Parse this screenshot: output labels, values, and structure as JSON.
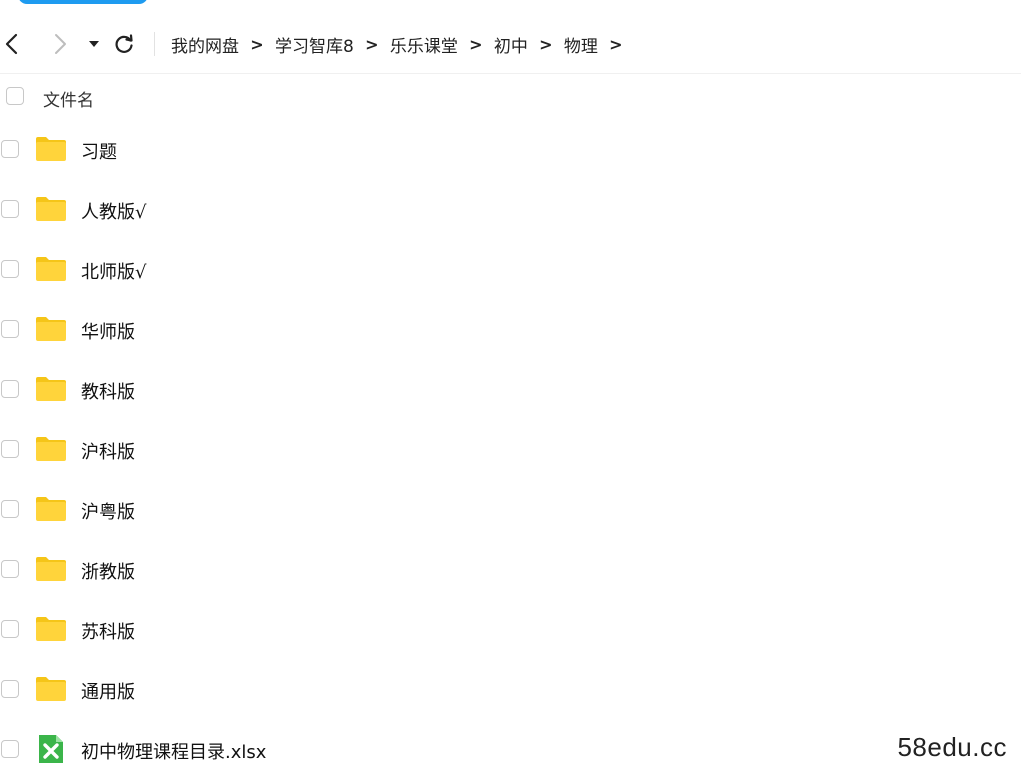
{
  "breadcrumb": [
    {
      "label": "我的网盘"
    },
    {
      "label": "学习智库8"
    },
    {
      "label": "乐乐课堂"
    },
    {
      "label": "初中"
    },
    {
      "label": "物理"
    }
  ],
  "breadcrumb_separator": ">",
  "list_header": {
    "column_label": "文件名"
  },
  "files": [
    {
      "name": "习题",
      "type": "folder"
    },
    {
      "name": "人教版√",
      "type": "folder"
    },
    {
      "name": "北师版√",
      "type": "folder"
    },
    {
      "name": "华师版",
      "type": "folder"
    },
    {
      "name": "教科版",
      "type": "folder"
    },
    {
      "name": "沪科版",
      "type": "folder"
    },
    {
      "name": "沪粤版",
      "type": "folder"
    },
    {
      "name": "浙教版",
      "type": "folder"
    },
    {
      "name": "苏科版",
      "type": "folder"
    },
    {
      "name": "通用版",
      "type": "folder"
    },
    {
      "name": "初中物理课程目录.xlsx",
      "type": "excel"
    }
  ],
  "icons": {
    "folder": "folder-icon",
    "excel": "excel-file-icon",
    "back": "chevron-left-icon",
    "forward": "chevron-right-icon",
    "history": "caret-down-icon",
    "refresh": "refresh-icon"
  },
  "colors": {
    "folder": "#FFD43B",
    "folder_tab": "#F5C518",
    "excel": "#3BB54A",
    "accent": "#1E9BF0"
  },
  "watermark": "58edu.cc"
}
